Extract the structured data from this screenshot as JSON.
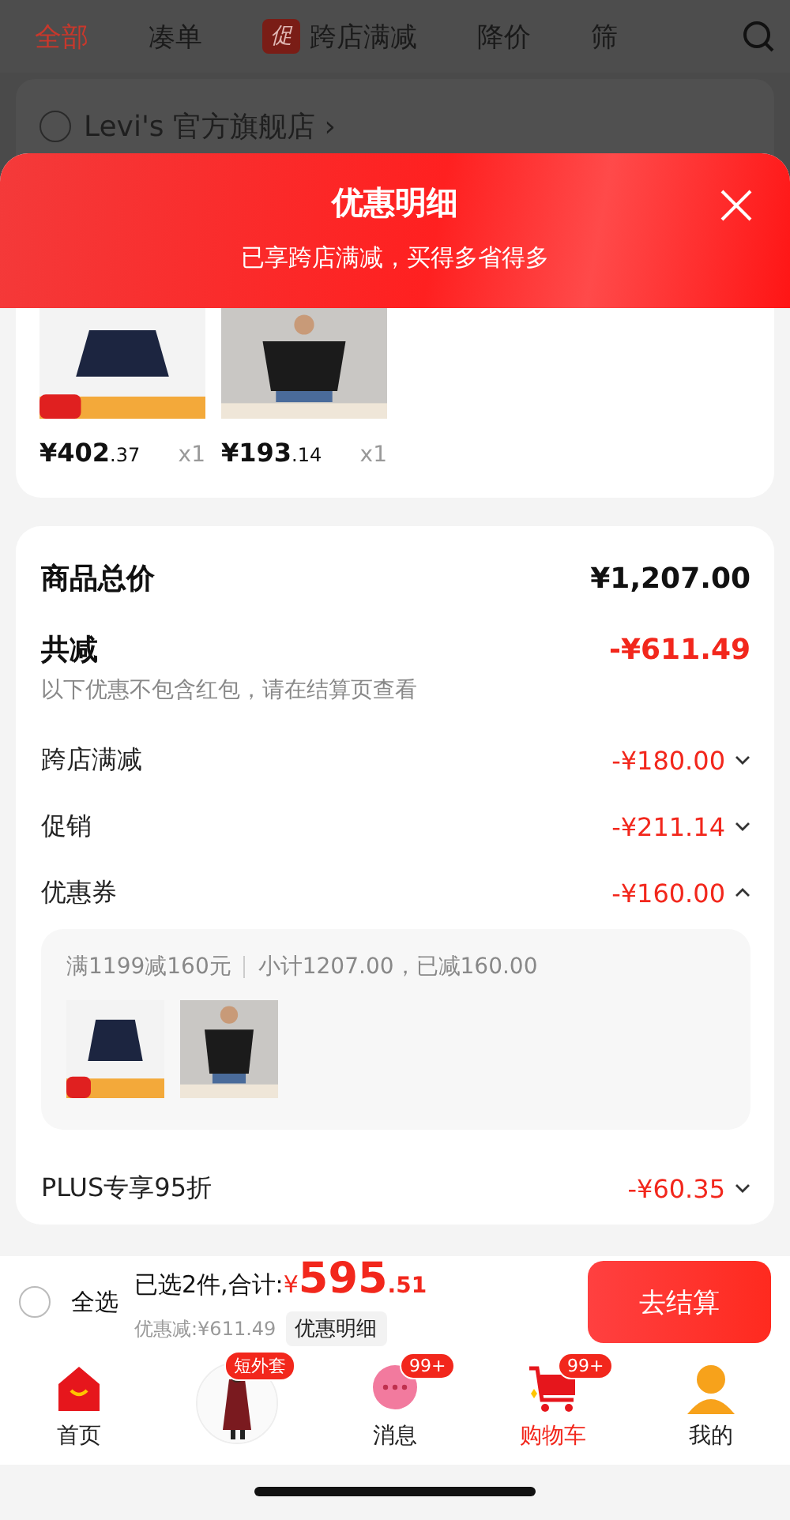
{
  "filter_tabs": [
    {
      "label": "全部",
      "selected": true
    },
    {
      "label": "凑单",
      "selected": false
    },
    {
      "label": "跨店满减",
      "selected": false,
      "badge": "促"
    },
    {
      "label": "降价",
      "selected": false
    },
    {
      "label": "筛",
      "selected": false
    }
  ],
  "store": {
    "name": "Levi's 官方旗舰店 ›",
    "checked": false
  },
  "sheet": {
    "title": "优惠明细",
    "subtitle": "已享跨店满减，买得多省得多"
  },
  "products": [
    {
      "price": "¥402",
      "decimal": ".37",
      "quantity": "x1"
    },
    {
      "price": "¥193",
      "decimal": ".14",
      "quantity": "x1"
    }
  ],
  "summary": {
    "total_label": "商品总价",
    "total_value": "¥1,207.00",
    "reduction_label": "共减",
    "reduction_value": "-¥611.49",
    "reduction_note": "以下优惠不包含红包，请在结算页查看"
  },
  "discounts": [
    {
      "label": "跨店满减",
      "value": "-¥180.00",
      "expanded": false
    },
    {
      "label": "促销",
      "value": "-¥211.14",
      "expanded": false
    },
    {
      "label": "优惠券",
      "value": "-¥160.00",
      "expanded": true,
      "detail": {
        "rule": "满1199减160元",
        "subtotal": "小计1207.00，已减160.00"
      }
    },
    {
      "label": "PLUS专享95折",
      "value": "-¥60.35",
      "expanded": false
    }
  ],
  "checkout_bar": {
    "select_all": {
      "label": "全选",
      "checked": false
    },
    "selected_text": "已选2件,合计:",
    "currency": "¥",
    "total": "595",
    "decimal": ".51",
    "discount_text": "优惠减:¥611.49",
    "detail_button": "优惠明细",
    "checkout_button": "去结算"
  },
  "nav": [
    {
      "kind": "home",
      "label": "首页",
      "selected": false
    },
    {
      "kind": "promo",
      "badge": "短外套",
      "selected": false
    },
    {
      "kind": "messages",
      "label": "消息",
      "badge": "99+",
      "selected": false
    },
    {
      "kind": "cart",
      "label": "购物车",
      "badge": "99+",
      "selected": true
    },
    {
      "kind": "me",
      "label": "我的",
      "selected": false
    }
  ]
}
